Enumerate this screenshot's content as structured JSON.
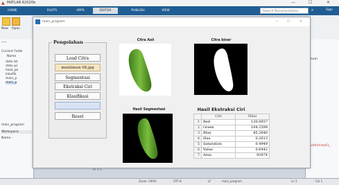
{
  "app": {
    "title": "MATLAB R2020b",
    "window_controls": [
      "—",
      "☐",
      "✕"
    ],
    "ribbon_tabs": [
      {
        "label": "HOME",
        "active": false
      },
      {
        "label": "PLOTS",
        "active": false
      },
      {
        "label": "APPS",
        "active": false
      },
      {
        "label": "EDITOR",
        "active": true
      },
      {
        "label": "PUBLISH",
        "active": false
      },
      {
        "label": "VIEW",
        "active": false
      }
    ],
    "search_placeholder": "Search Documentation",
    "sign_in": "Sign"
  },
  "ribbon": {
    "new_label": "New",
    "open_label": "Open"
  },
  "left_pane": {
    "current_folder": "Current Folde",
    "name_header": "Name",
    "files": [
      "data lat",
      "data uji",
      "hasil_pe",
      "klasifik",
      "main_p",
      "main_p"
    ],
    "open_file": "main_program",
    "workspace": "Workspace",
    "name_col": "Name -"
  },
  "right_pane": {
    "text": "anum",
    "link": "nostlhrt-test1_"
  },
  "command_prompt": "fx >>",
  "statusbar": [
    "Zoom: 100%",
    "UTF-8",
    "LF",
    "main_program",
    "Ln 1",
    "Col 1"
  ],
  "figure": {
    "title": "main_program",
    "controls": [
      "—",
      "☐",
      "✕"
    ],
    "panel_title": "Pengolahan",
    "buttons": {
      "load": "Load Citra",
      "segment": "Segmentasi",
      "extract": "Ekstraksi Ciri",
      "classify": "Klasifikasi",
      "reset": "Reset"
    },
    "filename": "mentimun 08.jpg",
    "result_field": "",
    "axes_titles": {
      "original": "Citra Asli",
      "binary": "Citra biner",
      "segmented": "Hasil Segmentasi"
    },
    "table": {
      "title": "Hasil Ekstraksi Ciri",
      "columns": [
        "Ciri",
        "Nilai"
      ],
      "rows": [
        {
          "idx": "1",
          "name": "Red",
          "value": "120.0937"
        },
        {
          "idx": "2",
          "name": "Green",
          "value": "164.2598"
        },
        {
          "idx": "3",
          "name": "Blue",
          "value": "85.2640"
        },
        {
          "idx": "4",
          "name": "Hue",
          "value": "0.2613"
        },
        {
          "idx": "5",
          "name": "Saturation",
          "value": "0.4949"
        },
        {
          "idx": "6",
          "name": "Value",
          "value": "0.6442"
        },
        {
          "idx": "7",
          "name": "Area",
          "value": "93874"
        }
      ]
    }
  },
  "colors": {
    "ribbon_blue": "#1f5d93",
    "cucumber_green": "#5fa12c",
    "field_bg": "#f7e6c3",
    "empty_field_bg": "#d9e3f3"
  }
}
